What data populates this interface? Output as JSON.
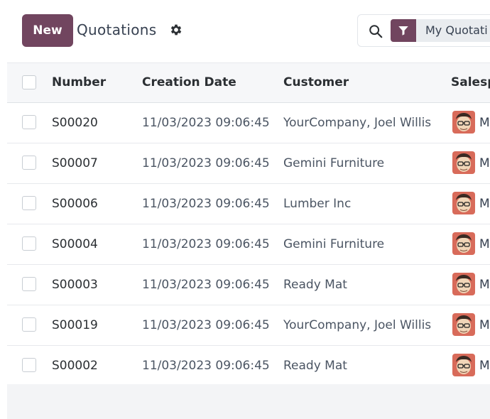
{
  "header": {
    "new_button": "New",
    "title": "Quotations",
    "search": {
      "facet_label": "My Quotati"
    }
  },
  "table": {
    "columns": [
      "Number",
      "Creation Date",
      "Customer",
      "Salesp"
    ],
    "rows": [
      {
        "number": "S00020",
        "date": "11/03/2023 09:06:45",
        "customer": "YourCompany, Joel Willis",
        "salesperson_initial": "M"
      },
      {
        "number": "S00007",
        "date": "11/03/2023 09:06:45",
        "customer": "Gemini Furniture",
        "salesperson_initial": "M"
      },
      {
        "number": "S00006",
        "date": "11/03/2023 09:06:45",
        "customer": "Lumber Inc",
        "salesperson_initial": "M"
      },
      {
        "number": "S00004",
        "date": "11/03/2023 09:06:45",
        "customer": "Gemini Furniture",
        "salesperson_initial": "M"
      },
      {
        "number": "S00003",
        "date": "11/03/2023 09:06:45",
        "customer": "Ready Mat",
        "salesperson_initial": "M"
      },
      {
        "number": "S00019",
        "date": "11/03/2023 09:06:45",
        "customer": "YourCompany, Joel Willis",
        "salesperson_initial": "M"
      },
      {
        "number": "S00002",
        "date": "11/03/2023 09:06:45",
        "customer": "Ready Mat",
        "salesperson_initial": "M"
      }
    ]
  },
  "colors": {
    "brand": "#71455f",
    "header_bg": "#f6f7f9",
    "facet_bg": "#e9ecef"
  },
  "icons": [
    "gear-icon",
    "search-icon",
    "filter-icon",
    "avatar"
  ]
}
